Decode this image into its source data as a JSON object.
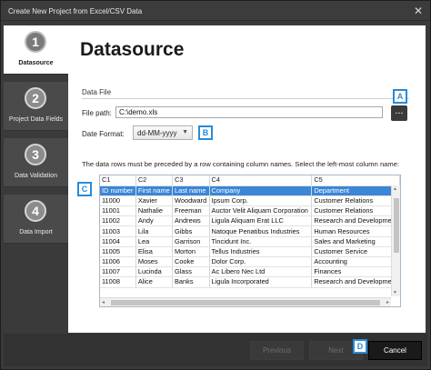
{
  "window": {
    "title": "Create New Project from Excel/CSV Data",
    "close_glyph": "✕"
  },
  "sidebar": {
    "steps": [
      {
        "number": "1",
        "label": "Datasource"
      },
      {
        "number": "2",
        "label": "Project Data Fields"
      },
      {
        "number": "3",
        "label": "Data Validation"
      },
      {
        "number": "4",
        "label": "Data Import"
      }
    ]
  },
  "main": {
    "heading": "Datasource",
    "data_file_label": "Data File",
    "file_path_label": "File path:",
    "file_path_value": "C:\\demo.xls",
    "browse_label": "...",
    "date_format_label": "Date Format:",
    "date_format_value": "dd-MM-yyyy",
    "description": "The data rows must be preceded by a row containing column names. Select the left-most column name:"
  },
  "grid": {
    "columns": [
      "C1",
      "C2",
      "C3",
      "C4",
      "C5"
    ],
    "rows": [
      [
        "ID number",
        "First name",
        "Last name",
        "Company",
        "Department"
      ],
      [
        "11000",
        "Xavier",
        "Woodward",
        "Ipsum Corp.",
        "Customer Relations"
      ],
      [
        "11001",
        "Nathalie",
        "Freeman",
        "Auctor Velit Aliquam Corporation",
        "Customer Relations"
      ],
      [
        "11002",
        "Andy",
        "Andrews",
        "Ligula Aliquam Erat LLC",
        "Research and Development"
      ],
      [
        "11003",
        "Lila",
        "Gibbs",
        "Natoque Penatibus Industries",
        "Human Resources"
      ],
      [
        "11004",
        "Lea",
        "Garrison",
        "Tincidunt Inc.",
        "Sales and Marketing"
      ],
      [
        "11005",
        "Elisa",
        "Morton",
        "Tellus Industries",
        "Customer Service"
      ],
      [
        "11006",
        "Moses",
        "Cooke",
        "Dolor Corp.",
        "Accounting"
      ],
      [
        "11007",
        "Lucinda",
        "Glass",
        "Ac Libero Nec Ltd",
        "Finances"
      ],
      [
        "11008",
        "Alice",
        "Banks",
        "Ligula Incorporated",
        "Research and Development"
      ]
    ]
  },
  "badges": {
    "a": "A",
    "b": "B",
    "c": "C",
    "d": "D"
  },
  "footer": {
    "previous": "Previous",
    "next": "Next",
    "cancel": "Cancel"
  },
  "colors": {
    "accent": "#2a8ad8",
    "selection": "#3b86d6",
    "chrome": "#3a3a3a"
  }
}
